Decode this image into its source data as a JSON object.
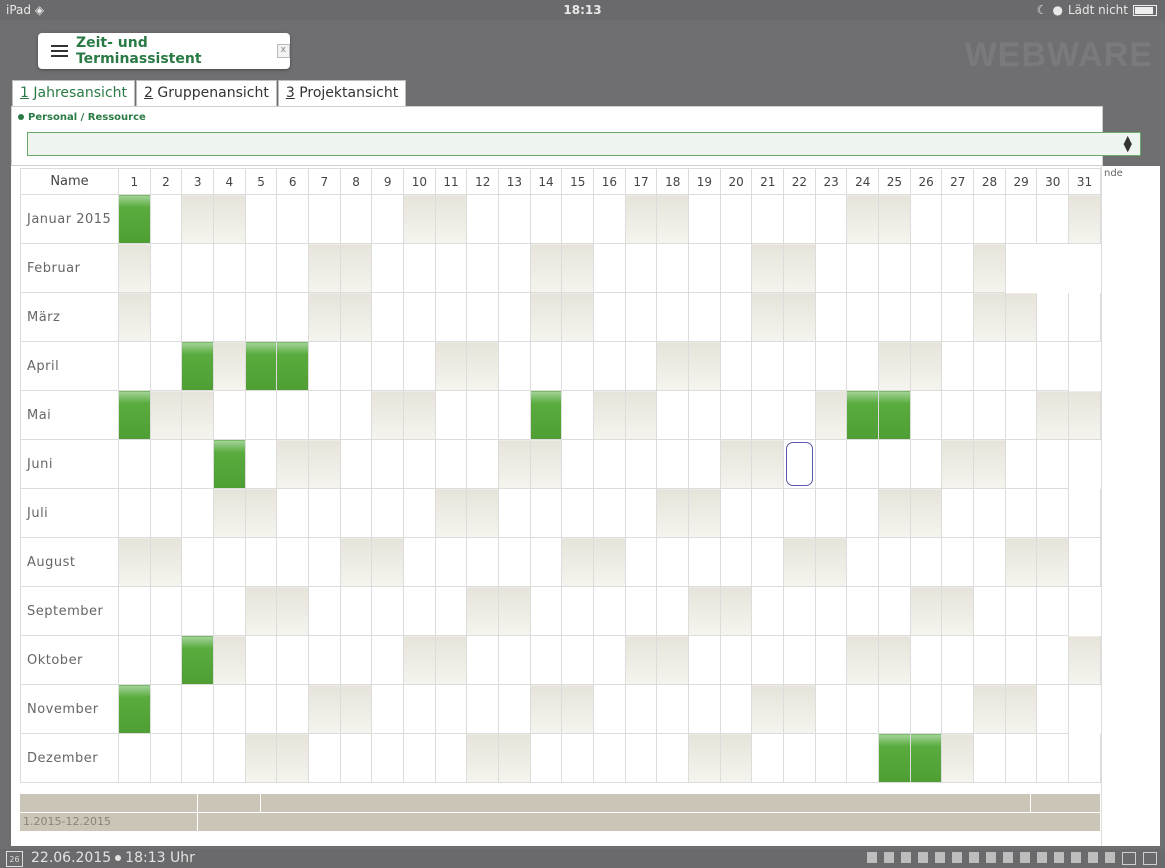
{
  "status": {
    "device": "iPad",
    "time": "18:13",
    "battery_text": "Lädt nicht"
  },
  "app": {
    "tab_title": "Zeit- und Terminassistent",
    "close_label": "x",
    "brand": "WEBWARE"
  },
  "view_tabs": [
    {
      "number": "1",
      "label": " Jahresansicht",
      "active": true
    },
    {
      "number": "2",
      "label": " Gruppenansicht",
      "active": false
    },
    {
      "number": "3",
      "label": " Projektansicht",
      "active": false
    }
  ],
  "resource": {
    "label": "Personal / Ressource",
    "value": ""
  },
  "calendar": {
    "name_header": "Name",
    "right_header": "nde",
    "days": [
      "1",
      "2",
      "3",
      "4",
      "5",
      "6",
      "7",
      "8",
      "9",
      "10",
      "11",
      "12",
      "13",
      "14",
      "15",
      "16",
      "17",
      "18",
      "19",
      "20",
      "21",
      "22",
      "23",
      "24",
      "25",
      "26",
      "27",
      "28",
      "29",
      "30",
      "31"
    ],
    "months": [
      {
        "name": "Januar 2015",
        "length": 31,
        "weekend": [
          3,
          4,
          10,
          11,
          17,
          18,
          24,
          25,
          31
        ],
        "events": [
          1
        ]
      },
      {
        "name": "Februar",
        "length": 28,
        "weekend": [
          1,
          7,
          8,
          14,
          15,
          21,
          22,
          28
        ],
        "events": []
      },
      {
        "name": "März",
        "length": 31,
        "weekend": [
          1,
          7,
          8,
          14,
          15,
          21,
          22,
          28,
          29
        ],
        "events": []
      },
      {
        "name": "April",
        "length": 30,
        "weekend": [
          4,
          5,
          11,
          12,
          18,
          19,
          25,
          26
        ],
        "events": [
          3,
          5,
          6
        ]
      },
      {
        "name": "Mai",
        "length": 31,
        "weekend": [
          2,
          3,
          9,
          10,
          16,
          17,
          23,
          24,
          30,
          31
        ],
        "events": [
          1,
          14,
          24,
          25
        ]
      },
      {
        "name": "Juni",
        "length": 30,
        "weekend": [
          6,
          7,
          13,
          14,
          20,
          21,
          27,
          28
        ],
        "events": [
          4
        ],
        "selected": 22
      },
      {
        "name": "Juli",
        "length": 31,
        "weekend": [
          4,
          5,
          11,
          12,
          18,
          19,
          25,
          26
        ],
        "events": []
      },
      {
        "name": "August",
        "length": 31,
        "weekend": [
          1,
          2,
          8,
          9,
          15,
          16,
          22,
          23,
          29,
          30
        ],
        "events": []
      },
      {
        "name": "September",
        "length": 30,
        "weekend": [
          5,
          6,
          12,
          13,
          19,
          20,
          26,
          27
        ],
        "events": []
      },
      {
        "name": "Oktober",
        "length": 31,
        "weekend": [
          3,
          4,
          10,
          11,
          17,
          18,
          24,
          25,
          31
        ],
        "events": [
          3
        ]
      },
      {
        "name": "November",
        "length": 30,
        "weekend": [
          1,
          7,
          8,
          14,
          15,
          21,
          22,
          28,
          29
        ],
        "events": [
          1
        ]
      },
      {
        "name": "Dezember",
        "length": 31,
        "weekend": [
          5,
          6,
          12,
          13,
          19,
          20,
          26,
          27
        ],
        "events": [
          25,
          26
        ]
      }
    ],
    "range_label": "1.2015-12.2015"
  },
  "bottom": {
    "calendar_icon_text": "26",
    "date": "22.06.2015",
    "time": "18:13 Uhr"
  },
  "toolbar_icons": [
    "building-icon",
    "users-icon",
    "bar-icon",
    "calculator-icon",
    "clipboard-icon",
    "network-icon",
    "card-icon",
    "lock-icon",
    "flask-icon",
    "fx-icon",
    "book-icon",
    "gear-icon",
    "grid-icon",
    "puzzle-icon",
    "calendar-small-icon",
    "window-icon",
    "mail-icon"
  ]
}
